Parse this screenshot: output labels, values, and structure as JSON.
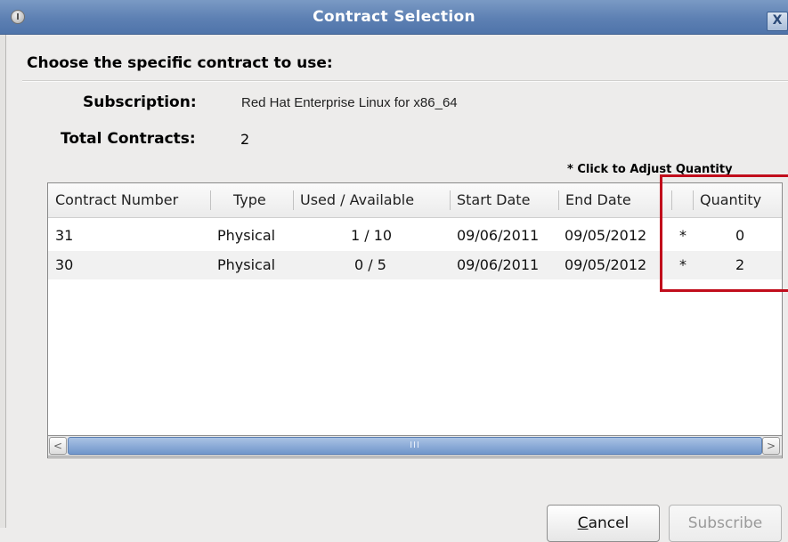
{
  "window": {
    "title": "Contract Selection",
    "close_glyph": "X",
    "menu_icon": "window-menu-icon"
  },
  "dialog": {
    "heading": "Choose the specific contract to use:",
    "subscription_label": "Subscription:",
    "subscription_value": "Red Hat Enterprise Linux for x86_64",
    "total_label": "Total Contracts:",
    "total_value": "2",
    "adjust_hint": "* Click to Adjust Quantity"
  },
  "table": {
    "columns": [
      "Contract Number",
      "Type",
      "Used / Available",
      "Start Date",
      "End Date",
      "",
      "Quantity"
    ],
    "rows": [
      {
        "contract": "31",
        "type": "Physical",
        "used": "1 / 10",
        "start": "09/06/2011",
        "end": "09/05/2012",
        "marker": "*",
        "quantity": "0"
      },
      {
        "contract": "30",
        "type": "Physical",
        "used": "0 / 5",
        "start": "09/06/2011",
        "end": "09/05/2012",
        "marker": "*",
        "quantity": "2"
      }
    ]
  },
  "scrollbar": {
    "left_arrow": "<",
    "right_arrow": ">",
    "thumb_grip": "III"
  },
  "buttons": {
    "cancel_mnemonic": "C",
    "cancel_rest": "ancel",
    "subscribe": "Subscribe"
  },
  "colors": {
    "titlebar": "#5d80b3",
    "highlight": "#c10d1c"
  }
}
